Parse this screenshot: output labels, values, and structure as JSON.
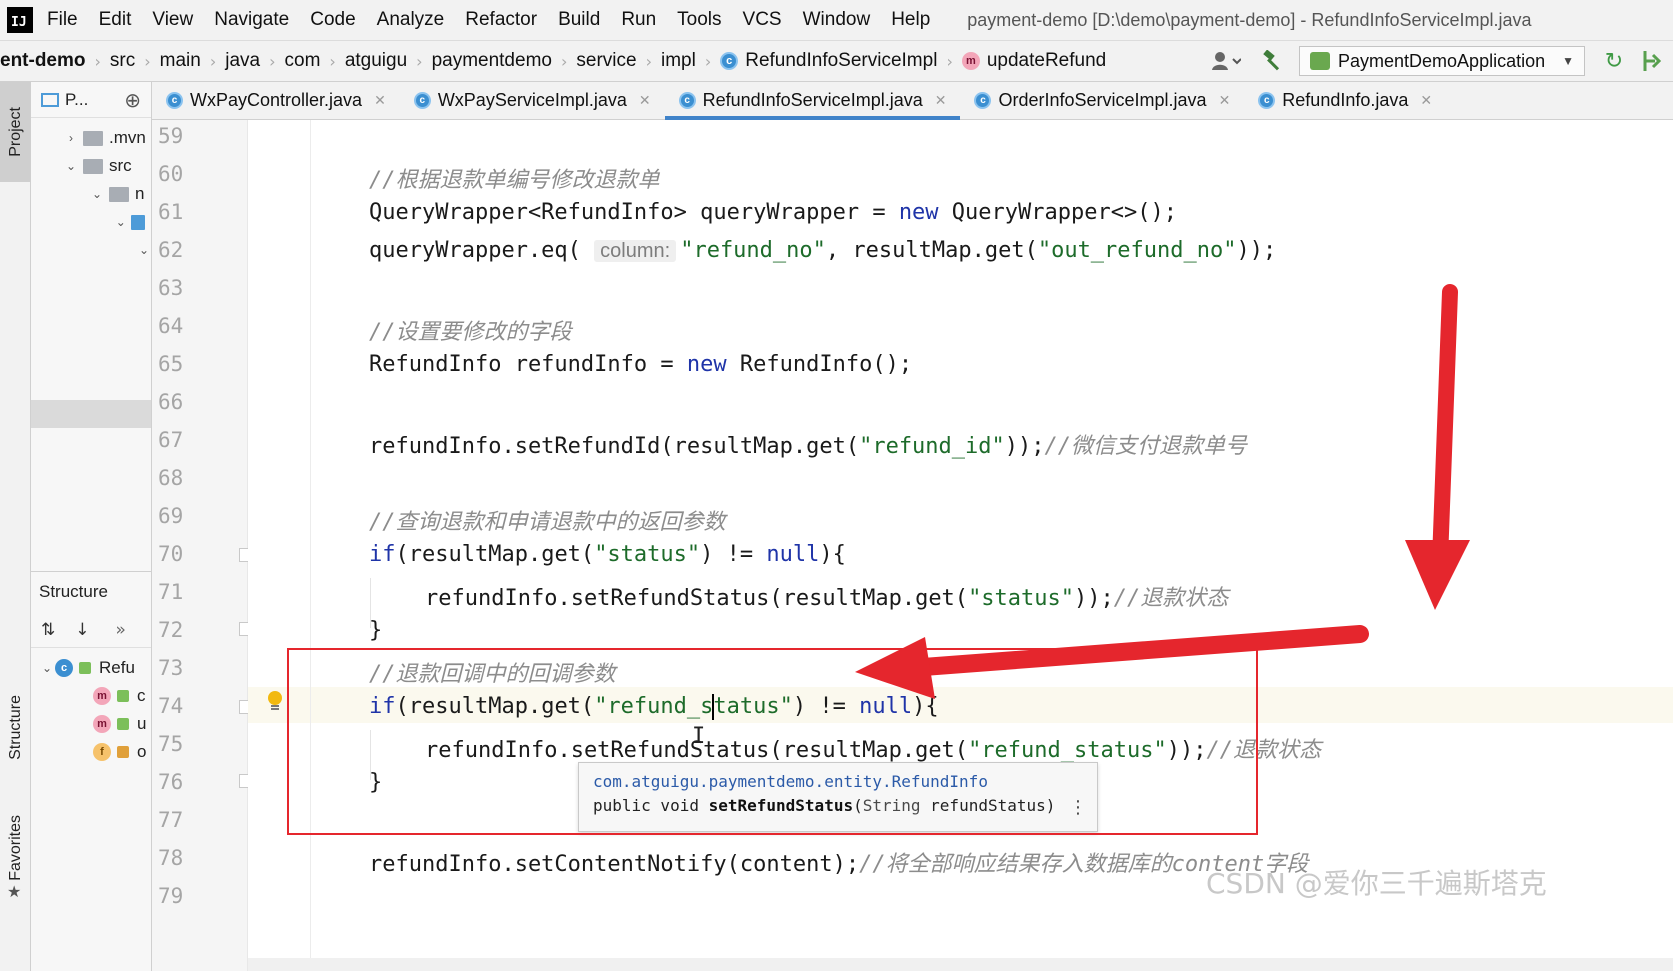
{
  "menubar": {
    "logo": "IJ",
    "items": [
      "File",
      "Edit",
      "View",
      "Navigate",
      "Code",
      "Analyze",
      "Refactor",
      "Build",
      "Run",
      "Tools",
      "VCS",
      "Window",
      "Help"
    ],
    "window_title": "payment-demo [D:\\demo\\payment-demo] - RefundInfoServiceImpl.java"
  },
  "navbar": {
    "crumbs": [
      "ent-demo",
      "src",
      "main",
      "java",
      "com",
      "atguigu",
      "paymentdemo",
      "service",
      "impl"
    ],
    "class_crumb": "RefundInfoServiceImpl",
    "method_crumb": "updateRefund",
    "run_config": "PaymentDemoApplication"
  },
  "tool_strip": {
    "project": "Project",
    "structure": "Structure",
    "favorites": "Favorites"
  },
  "project_panel": {
    "title": "P...",
    "tree": [
      {
        "label": ".mvn",
        "caret": "›",
        "depth": 0,
        "color": "gray"
      },
      {
        "label": "src",
        "caret": "⌄",
        "depth": 0,
        "color": "gray"
      },
      {
        "label": "n",
        "caret": "⌄",
        "depth": 1,
        "color": "gray"
      },
      {
        "label": "",
        "caret": "⌄",
        "depth": 2,
        "color": "blue"
      },
      {
        "label": "",
        "caret": "⌄",
        "depth": 3,
        "color": "none"
      }
    ]
  },
  "structure_panel": {
    "title": "Structure",
    "items": [
      {
        "badge": "c",
        "label": "Refu"
      },
      {
        "badge": "m",
        "label": "c"
      },
      {
        "badge": "m",
        "label": "u"
      },
      {
        "badge": "f",
        "label": "o"
      }
    ]
  },
  "tabs": [
    {
      "label": "WxPayController.java",
      "active": false
    },
    {
      "label": "WxPayServiceImpl.java",
      "active": false
    },
    {
      "label": "RefundInfoServiceImpl.java",
      "active": true
    },
    {
      "label": "OrderInfoServiceImpl.java",
      "active": false
    },
    {
      "label": "RefundInfo.java",
      "active": false
    }
  ],
  "gutter": {
    "line_numbers": [
      "59",
      "60",
      "61",
      "62",
      "63",
      "64",
      "65",
      "66",
      "67",
      "68",
      "69",
      "70",
      "71",
      "72",
      "73",
      "74",
      "75",
      "76",
      "77",
      "78",
      "79"
    ]
  },
  "code": {
    "l60": "//根据退款单编号修改退款单",
    "l61_a": "QueryWrapper<RefundInfo> queryWrapper = ",
    "l61_kw": "new",
    "l61_b": " QueryWrapper<>();",
    "l62_a": "queryWrapper.eq( ",
    "l62_hint": "column:",
    "l62_s1": "\"refund_no\"",
    "l62_b": ", resultMap.get(",
    "l62_s2": "\"out_refund_no\"",
    "l62_c": "));",
    "l64": "//设置要修改的字段",
    "l65_a": "RefundInfo refundInfo = ",
    "l65_kw": "new",
    "l65_b": " RefundInfo();",
    "l67_a": "refundInfo.setRefundId(resultMap.get(",
    "l67_s": "\"refund_id\"",
    "l67_b": "));",
    "l67_c": "//微信支付退款单号",
    "l69": "//查询退款和申请退款中的返回参数",
    "l70_kw": "if",
    "l70_a": "(resultMap.get(",
    "l70_s": "\"status\"",
    "l70_b": ") != ",
    "l70_null": "null",
    "l70_c": "){",
    "l71_a": "refundInfo.setRefundStatus(resultMap.get(",
    "l71_s": "\"status\"",
    "l71_b": "));",
    "l71_c": "//退款状态",
    "l72": "}",
    "l73": "//退款回调中的回调参数",
    "l74_kw": "if",
    "l74_a": "(resultMap.get(",
    "l74_s1": "\"refund_s",
    "l74_s2": "tatus\"",
    "l74_b": ") != ",
    "l74_null": "null",
    "l74_c": "){",
    "l75_a": "refundInfo.setRefundStatus(resultMap.get(",
    "l75_s": "\"refund_status\"",
    "l75_b": "));",
    "l75_c": "//退款状态",
    "l76": "}",
    "l78_a": "refundInfo.setContentNotify(content);",
    "l78_c": "//将全部响应结果存入数据库的content字段"
  },
  "doc_popup": {
    "package": "com.atguigu.paymentdemo.entity.RefundInfo",
    "sig_a": "public void ",
    "sig_method": "setRefundStatus",
    "sig_b": "(",
    "sig_type": "String",
    "sig_c": " refundStatus)",
    "more": "⋮"
  },
  "annotation": {
    "color": "#e5262d"
  },
  "watermark": "CSDN @爱你三千遍斯塔克"
}
